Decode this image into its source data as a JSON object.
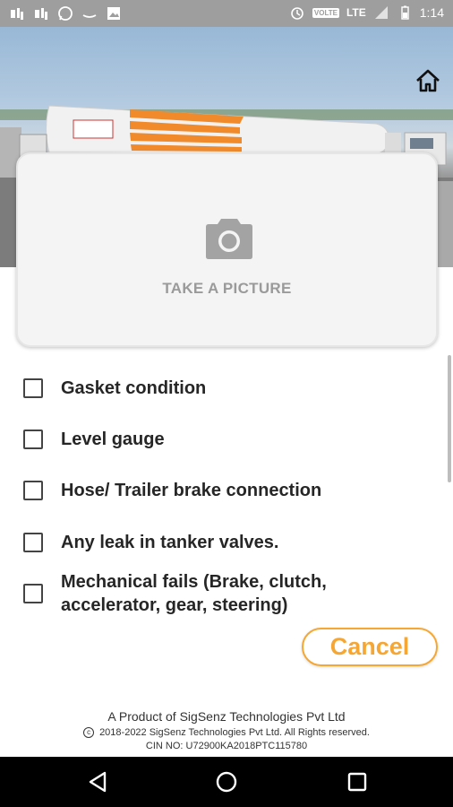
{
  "status_bar": {
    "left_icons": [
      "dji-icon",
      "dji-icon",
      "whatsapp-icon",
      "amazon-icon",
      "image-icon"
    ],
    "network": "LTE",
    "volte": "VOLTE",
    "time": "1:14"
  },
  "header": {
    "home_icon": "home-icon"
  },
  "picture_card": {
    "icon": "camera-icon",
    "label": "TAKE A PICTURE"
  },
  "checklist": {
    "items": [
      {
        "label": "Gasket condition",
        "checked": false
      },
      {
        "label": "Level gauge",
        "checked": false
      },
      {
        "label": "Hose/ Trailer brake connection",
        "checked": false
      },
      {
        "label": "Any leak in tanker valves.",
        "checked": false
      },
      {
        "label": "Mechanical fails (Brake, clutch, accelerator, gear, steering)",
        "checked": false
      }
    ]
  },
  "actions": {
    "cancel_label": "Cancel"
  },
  "footer": {
    "product": "A Product of SigSenz Technologies Pvt Ltd",
    "rights": "2018-2022 SigSenz Technologies Pvt Ltd. All Rights reserved.",
    "cin": "CIN NO: U72900KA2018PTC115780"
  },
  "colors": {
    "accent": "#f6a733",
    "text": "#262626",
    "card_bg": "#f4f4f4"
  }
}
